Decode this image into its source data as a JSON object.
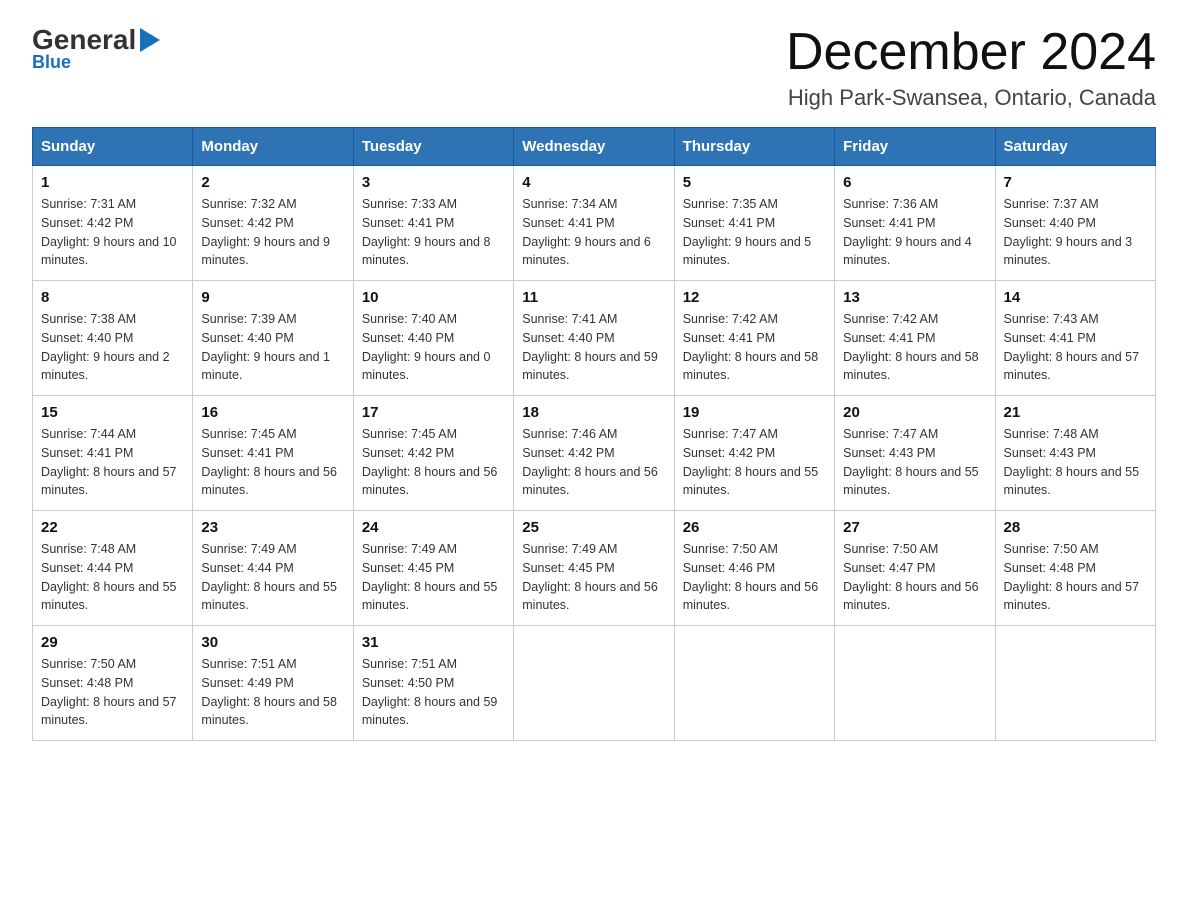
{
  "logo": {
    "general": "General",
    "blue": "Blue"
  },
  "header": {
    "title": "December 2024",
    "subtitle": "High Park-Swansea, Ontario, Canada"
  },
  "days_of_week": [
    "Sunday",
    "Monday",
    "Tuesday",
    "Wednesday",
    "Thursday",
    "Friday",
    "Saturday"
  ],
  "weeks": [
    [
      {
        "day": "1",
        "sunrise": "7:31 AM",
        "sunset": "4:42 PM",
        "daylight": "9 hours and 10 minutes."
      },
      {
        "day": "2",
        "sunrise": "7:32 AM",
        "sunset": "4:42 PM",
        "daylight": "9 hours and 9 minutes."
      },
      {
        "day": "3",
        "sunrise": "7:33 AM",
        "sunset": "4:41 PM",
        "daylight": "9 hours and 8 minutes."
      },
      {
        "day": "4",
        "sunrise": "7:34 AM",
        "sunset": "4:41 PM",
        "daylight": "9 hours and 6 minutes."
      },
      {
        "day": "5",
        "sunrise": "7:35 AM",
        "sunset": "4:41 PM",
        "daylight": "9 hours and 5 minutes."
      },
      {
        "day": "6",
        "sunrise": "7:36 AM",
        "sunset": "4:41 PM",
        "daylight": "9 hours and 4 minutes."
      },
      {
        "day": "7",
        "sunrise": "7:37 AM",
        "sunset": "4:40 PM",
        "daylight": "9 hours and 3 minutes."
      }
    ],
    [
      {
        "day": "8",
        "sunrise": "7:38 AM",
        "sunset": "4:40 PM",
        "daylight": "9 hours and 2 minutes."
      },
      {
        "day": "9",
        "sunrise": "7:39 AM",
        "sunset": "4:40 PM",
        "daylight": "9 hours and 1 minute."
      },
      {
        "day": "10",
        "sunrise": "7:40 AM",
        "sunset": "4:40 PM",
        "daylight": "9 hours and 0 minutes."
      },
      {
        "day": "11",
        "sunrise": "7:41 AM",
        "sunset": "4:40 PM",
        "daylight": "8 hours and 59 minutes."
      },
      {
        "day": "12",
        "sunrise": "7:42 AM",
        "sunset": "4:41 PM",
        "daylight": "8 hours and 58 minutes."
      },
      {
        "day": "13",
        "sunrise": "7:42 AM",
        "sunset": "4:41 PM",
        "daylight": "8 hours and 58 minutes."
      },
      {
        "day": "14",
        "sunrise": "7:43 AM",
        "sunset": "4:41 PM",
        "daylight": "8 hours and 57 minutes."
      }
    ],
    [
      {
        "day": "15",
        "sunrise": "7:44 AM",
        "sunset": "4:41 PM",
        "daylight": "8 hours and 57 minutes."
      },
      {
        "day": "16",
        "sunrise": "7:45 AM",
        "sunset": "4:41 PM",
        "daylight": "8 hours and 56 minutes."
      },
      {
        "day": "17",
        "sunrise": "7:45 AM",
        "sunset": "4:42 PM",
        "daylight": "8 hours and 56 minutes."
      },
      {
        "day": "18",
        "sunrise": "7:46 AM",
        "sunset": "4:42 PM",
        "daylight": "8 hours and 56 minutes."
      },
      {
        "day": "19",
        "sunrise": "7:47 AM",
        "sunset": "4:42 PM",
        "daylight": "8 hours and 55 minutes."
      },
      {
        "day": "20",
        "sunrise": "7:47 AM",
        "sunset": "4:43 PM",
        "daylight": "8 hours and 55 minutes."
      },
      {
        "day": "21",
        "sunrise": "7:48 AM",
        "sunset": "4:43 PM",
        "daylight": "8 hours and 55 minutes."
      }
    ],
    [
      {
        "day": "22",
        "sunrise": "7:48 AM",
        "sunset": "4:44 PM",
        "daylight": "8 hours and 55 minutes."
      },
      {
        "day": "23",
        "sunrise": "7:49 AM",
        "sunset": "4:44 PM",
        "daylight": "8 hours and 55 minutes."
      },
      {
        "day": "24",
        "sunrise": "7:49 AM",
        "sunset": "4:45 PM",
        "daylight": "8 hours and 55 minutes."
      },
      {
        "day": "25",
        "sunrise": "7:49 AM",
        "sunset": "4:45 PM",
        "daylight": "8 hours and 56 minutes."
      },
      {
        "day": "26",
        "sunrise": "7:50 AM",
        "sunset": "4:46 PM",
        "daylight": "8 hours and 56 minutes."
      },
      {
        "day": "27",
        "sunrise": "7:50 AM",
        "sunset": "4:47 PM",
        "daylight": "8 hours and 56 minutes."
      },
      {
        "day": "28",
        "sunrise": "7:50 AM",
        "sunset": "4:48 PM",
        "daylight": "8 hours and 57 minutes."
      }
    ],
    [
      {
        "day": "29",
        "sunrise": "7:50 AM",
        "sunset": "4:48 PM",
        "daylight": "8 hours and 57 minutes."
      },
      {
        "day": "30",
        "sunrise": "7:51 AM",
        "sunset": "4:49 PM",
        "daylight": "8 hours and 58 minutes."
      },
      {
        "day": "31",
        "sunrise": "7:51 AM",
        "sunset": "4:50 PM",
        "daylight": "8 hours and 59 minutes."
      },
      null,
      null,
      null,
      null
    ]
  ],
  "labels": {
    "sunrise": "Sunrise:",
    "sunset": "Sunset:",
    "daylight": "Daylight:"
  }
}
